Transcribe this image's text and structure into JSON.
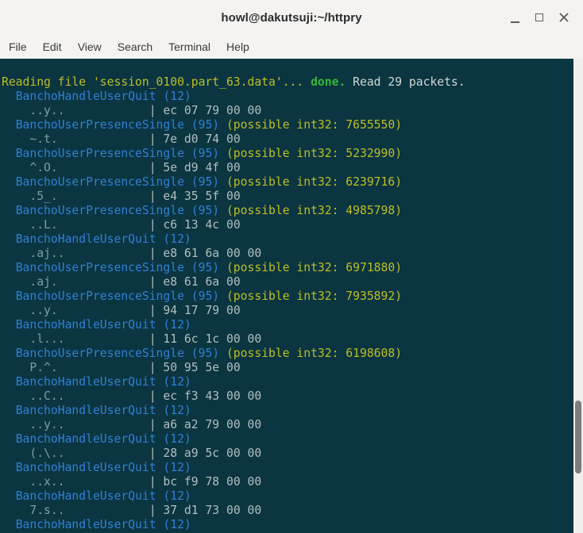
{
  "window": {
    "title": "howl@dakutsuji:~/httpry",
    "controls": [
      "minimize",
      "maximize",
      "close"
    ]
  },
  "menu": {
    "items": [
      "File",
      "Edit",
      "View",
      "Search",
      "Terminal",
      "Help"
    ]
  },
  "colors": {
    "chrome_bg": "#f4f3f1",
    "title_fg": "#2c2c2c",
    "menu_fg": "#3a3a3a",
    "control_fg": "#5c5c5c",
    "terminal_bg": "#0b3541",
    "yellow": "#bdbe25",
    "green": "#36b836",
    "blue": "#2f81d5",
    "fg": "#d0d8d5",
    "ascii": "#7b9dae",
    "hex": "#b2bfc2",
    "scrollbar_track": "#f0efed",
    "scrollbar_thumb": "#7d7d7d"
  },
  "terminal": {
    "format": {
      "ascii_pad": 17,
      "separator": "| ",
      "packet_indent": "  ",
      "dump_indent": "    "
    },
    "lines": [
      {
        "type": "status",
        "reading": "Reading file 'session_0100.part_63.data'...",
        "done": "done.",
        "read": "Read 29 packets."
      },
      {
        "type": "packet",
        "label": "BanchoHandleUserQuit (12)",
        "note": ""
      },
      {
        "type": "dump",
        "ascii": "..y..",
        "hex": "ec 07 79 00 00"
      },
      {
        "type": "packet",
        "label": "BanchoUserPresenceSingle (95)",
        "note": "(possible int32: 7655550)"
      },
      {
        "type": "dump",
        "ascii": "~.t.",
        "hex": "7e d0 74 00"
      },
      {
        "type": "packet",
        "label": "BanchoUserPresenceSingle (95)",
        "note": "(possible int32: 5232990)"
      },
      {
        "type": "dump",
        "ascii": "^.O.",
        "hex": "5e d9 4f 00"
      },
      {
        "type": "packet",
        "label": "BanchoUserPresenceSingle (95)",
        "note": "(possible int32: 6239716)"
      },
      {
        "type": "dump",
        "ascii": ".5_.",
        "hex": "e4 35 5f 00"
      },
      {
        "type": "packet",
        "label": "BanchoUserPresenceSingle (95)",
        "note": "(possible int32: 4985798)"
      },
      {
        "type": "dump",
        "ascii": "..L.",
        "hex": "c6 13 4c 00"
      },
      {
        "type": "packet",
        "label": "BanchoHandleUserQuit (12)",
        "note": ""
      },
      {
        "type": "dump",
        "ascii": ".aj..",
        "hex": "e8 61 6a 00 00"
      },
      {
        "type": "packet",
        "label": "BanchoUserPresenceSingle (95)",
        "note": "(possible int32: 6971880)"
      },
      {
        "type": "dump",
        "ascii": ".aj.",
        "hex": "e8 61 6a 00"
      },
      {
        "type": "packet",
        "label": "BanchoUserPresenceSingle (95)",
        "note": "(possible int32: 7935892)"
      },
      {
        "type": "dump",
        "ascii": "..y.",
        "hex": "94 17 79 00"
      },
      {
        "type": "packet",
        "label": "BanchoHandleUserQuit (12)",
        "note": ""
      },
      {
        "type": "dump",
        "ascii": ".l...",
        "hex": "11 6c 1c 00 00"
      },
      {
        "type": "packet",
        "label": "BanchoUserPresenceSingle (95)",
        "note": "(possible int32: 6198608)"
      },
      {
        "type": "dump",
        "ascii": "P.^.",
        "hex": "50 95 5e 00"
      },
      {
        "type": "packet",
        "label": "BanchoHandleUserQuit (12)",
        "note": ""
      },
      {
        "type": "dump",
        "ascii": "..C..",
        "hex": "ec f3 43 00 00"
      },
      {
        "type": "packet",
        "label": "BanchoHandleUserQuit (12)",
        "note": ""
      },
      {
        "type": "dump",
        "ascii": "..y..",
        "hex": "a6 a2 79 00 00"
      },
      {
        "type": "packet",
        "label": "BanchoHandleUserQuit (12)",
        "note": ""
      },
      {
        "type": "dump",
        "ascii": "(.\\..",
        "hex": "28 a9 5c 00 00"
      },
      {
        "type": "packet",
        "label": "BanchoHandleUserQuit (12)",
        "note": ""
      },
      {
        "type": "dump",
        "ascii": "..x..",
        "hex": "bc f9 78 00 00"
      },
      {
        "type": "packet",
        "label": "BanchoHandleUserQuit (12)",
        "note": ""
      },
      {
        "type": "dump",
        "ascii": "7.s..",
        "hex": "37 d1 73 00 00"
      },
      {
        "type": "packet",
        "label": "BanchoHandleUserQuit (12)",
        "note": ""
      }
    ]
  }
}
